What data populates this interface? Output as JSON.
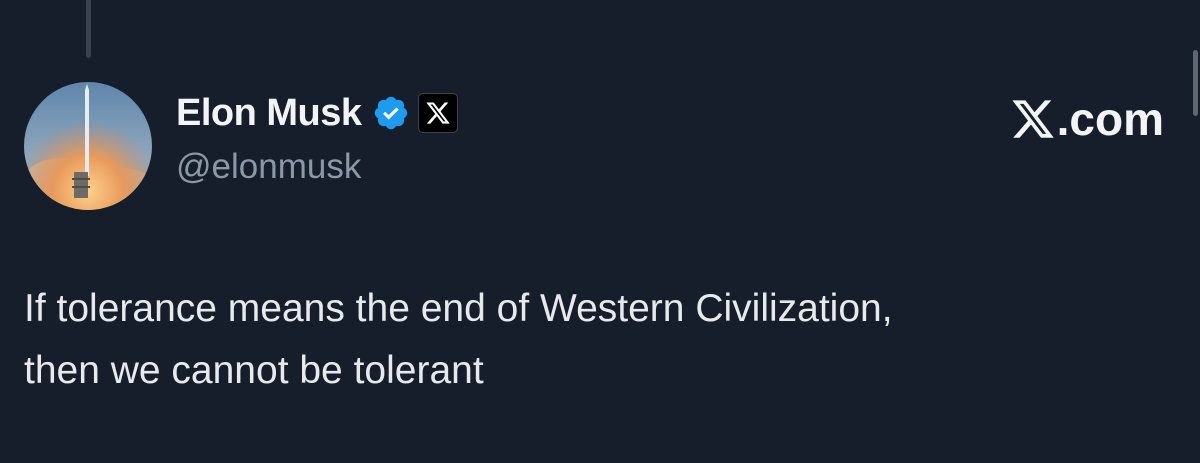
{
  "tweet": {
    "author": {
      "display_name": "Elon Musk",
      "handle": "@elonmusk",
      "verified": true,
      "verified_badge_color": "#1d9bf0",
      "affiliation_icon": "x-logo-icon"
    },
    "brand_label": ".com",
    "brand_icon": "x-logo-icon",
    "text_lines": [
      "If tolerance means the end of Western Civilization,",
      "then we cannot be tolerant"
    ]
  },
  "colors": {
    "background": "#161d2b",
    "text_primary": "#e7e9ea",
    "text_secondary": "#8b98a5"
  }
}
